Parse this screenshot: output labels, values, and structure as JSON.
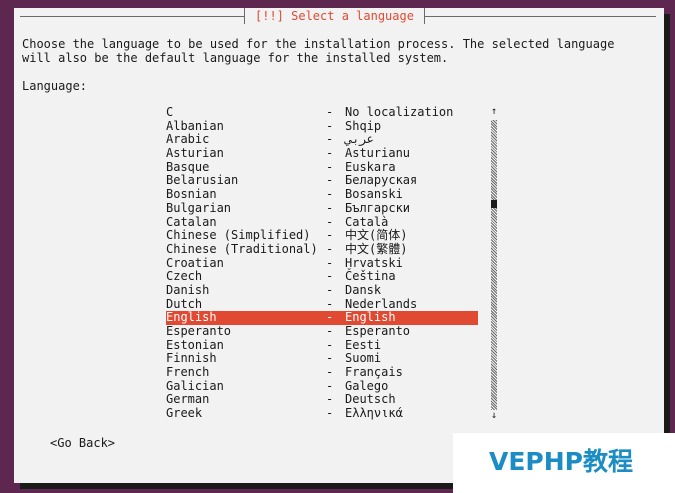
{
  "dialog": {
    "title": "[!!] Select a language",
    "intro": "Choose the language to be used for the installation process. The selected language will also be the default language for the installed system.",
    "language_label": "Language:",
    "go_back_label": "<Go Back>"
  },
  "languages": [
    {
      "name": "C",
      "native": "No localization"
    },
    {
      "name": "Albanian",
      "native": "Shqip"
    },
    {
      "name": "Arabic",
      "native": "عربي"
    },
    {
      "name": "Asturian",
      "native": "Asturianu"
    },
    {
      "name": "Basque",
      "native": "Euskara"
    },
    {
      "name": "Belarusian",
      "native": "Беларуская"
    },
    {
      "name": "Bosnian",
      "native": "Bosanski"
    },
    {
      "name": "Bulgarian",
      "native": "Български"
    },
    {
      "name": "Catalan",
      "native": "Català"
    },
    {
      "name": "Chinese (Simplified)",
      "native": "中文(简体)"
    },
    {
      "name": "Chinese (Traditional)",
      "native": "中文(繁體)"
    },
    {
      "name": "Croatian",
      "native": "Hrvatski"
    },
    {
      "name": "Czech",
      "native": "Čeština"
    },
    {
      "name": "Danish",
      "native": "Dansk"
    },
    {
      "name": "Dutch",
      "native": "Nederlands"
    },
    {
      "name": "English",
      "native": "English",
      "selected": true
    },
    {
      "name": "Esperanto",
      "native": "Esperanto"
    },
    {
      "name": "Estonian",
      "native": "Eesti"
    },
    {
      "name": "Finnish",
      "native": "Suomi"
    },
    {
      "name": "French",
      "native": "Français"
    },
    {
      "name": "Galician",
      "native": "Galego"
    },
    {
      "name": "German",
      "native": "Deutsch"
    },
    {
      "name": "Greek",
      "native": "Ελληνικά"
    }
  ],
  "list_separator": "-",
  "scrollbar": {
    "up_arrow": "↑",
    "down_arrow": "↓"
  },
  "watermark": {
    "text": "VEPHP教程"
  },
  "colors": {
    "background": "#5e2750",
    "dialog": "#f2f2f2",
    "accent": "#e04a33",
    "watermark": "#1b8dc4"
  }
}
